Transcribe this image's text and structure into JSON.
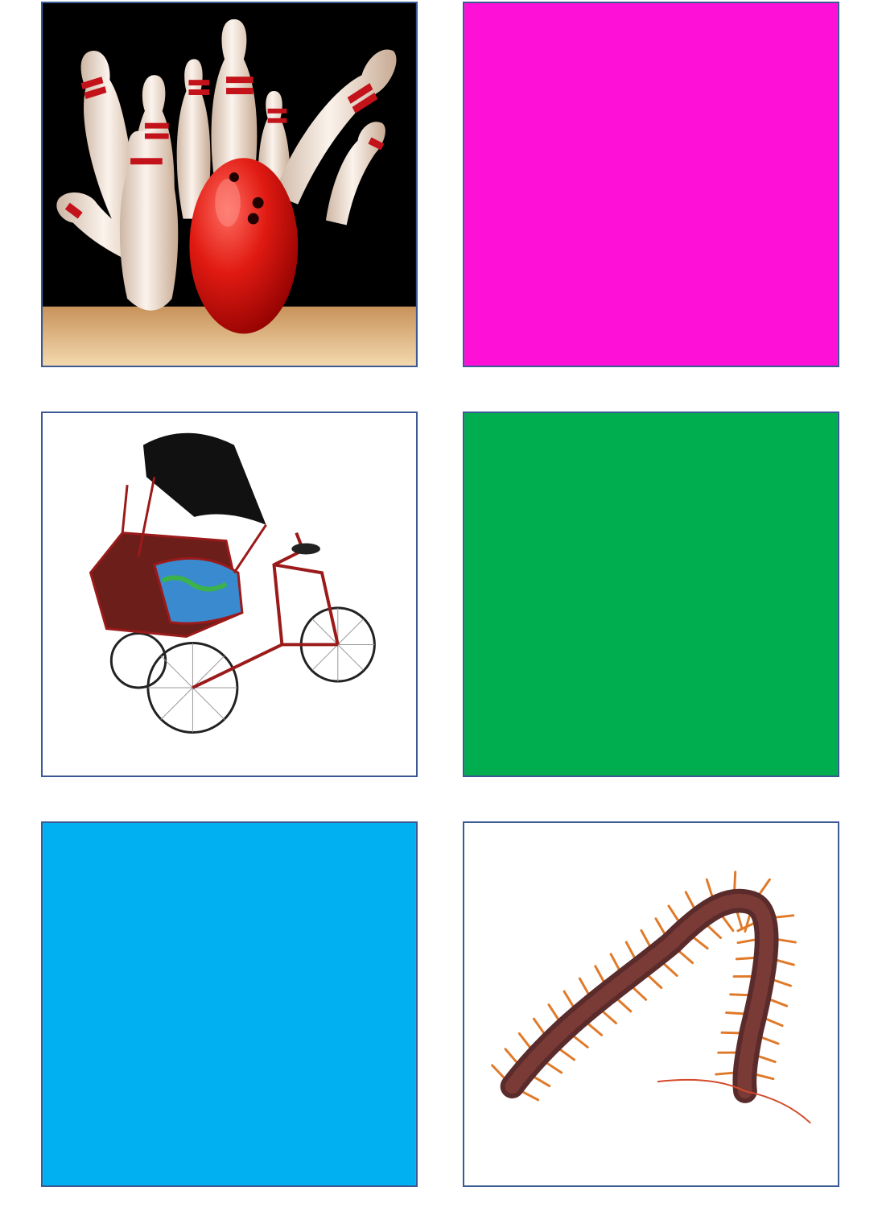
{
  "cards": [
    {
      "kind": "picture",
      "subject": "bowling-pins-and-ball",
      "background": "#000000"
    },
    {
      "kind": "color",
      "color": "#ff10d6"
    },
    {
      "kind": "picture",
      "subject": "cycle-rickshaw",
      "background": "#ffffff"
    },
    {
      "kind": "color",
      "color": "#00ae4f"
    },
    {
      "kind": "color",
      "color": "#00b0f0"
    },
    {
      "kind": "picture",
      "subject": "centipede",
      "background": "#ffffff"
    }
  ],
  "colors": {
    "border": "#3b5a94"
  }
}
